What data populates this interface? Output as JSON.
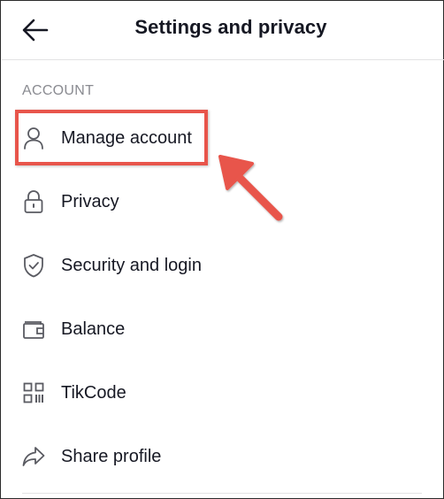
{
  "header": {
    "title": "Settings and privacy",
    "back_icon": "arrow-left-icon"
  },
  "section": {
    "label": "ACCOUNT"
  },
  "menu": {
    "items": [
      {
        "label": "Manage account",
        "icon": "person-icon"
      },
      {
        "label": "Privacy",
        "icon": "lock-icon"
      },
      {
        "label": "Security and login",
        "icon": "shield-check-icon"
      },
      {
        "label": "Balance",
        "icon": "wallet-icon"
      },
      {
        "label": "TikCode",
        "icon": "qr-code-icon"
      },
      {
        "label": "Share profile",
        "icon": "share-icon"
      }
    ]
  },
  "annotation": {
    "highlight_color": "#e8554b",
    "target": "Manage account"
  },
  "colors": {
    "text": "#161823",
    "muted": "#8a8b91",
    "icon": "#5a5b62",
    "divider": "#e3e3e4"
  }
}
